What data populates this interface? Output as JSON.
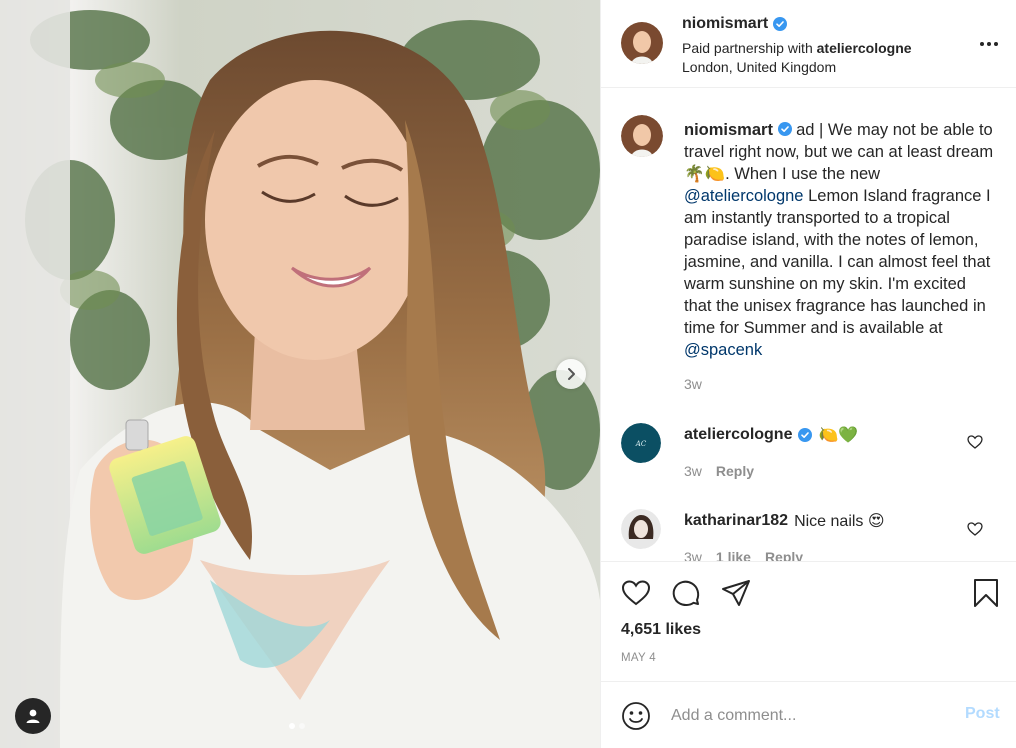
{
  "post": {
    "author": "niomismart",
    "partnership_prefix": "Paid partnership with",
    "partner": "ateliercologne",
    "location": "London, United Kingdom",
    "more_icon": "more-horizontal-icon"
  },
  "caption": {
    "username": "niomismart",
    "part1": "ad | We may not be able to travel right now, but we can at least dream 🌴🍋. When I use the new",
    "mention1": "@ateliercologne",
    "part2": "Lemon Island fragrance I am instantly transported to a tropical paradise island, with the notes of lemon, jasmine, and vanilla. I can almost feel that warm sunshine on my skin. I'm excited that the unisex fragrance has launched in time for Summer and is available at",
    "mention2": "@spacenk",
    "time": "3w"
  },
  "comments": [
    {
      "username": "ateliercologne",
      "text": "🍋💚",
      "time": "3w",
      "reply_label": "Reply",
      "verified": true
    },
    {
      "username": "katharinar182",
      "text": "Nice nails 😍",
      "time": "3w",
      "likes": "1 like",
      "reply_label": "Reply",
      "verified": false
    }
  ],
  "actions": {
    "likes": "4,651 likes",
    "date": "MAY 4",
    "icons": [
      "heart-icon",
      "comment-icon",
      "share-icon",
      "bookmark-icon"
    ]
  },
  "add_comment": {
    "placeholder": "Add a comment...",
    "post_label": "Post"
  },
  "colors": {
    "verified": "#3897f0",
    "link": "#00376b",
    "muted": "#8e8e8e",
    "post_disabled": "#b3dbff"
  }
}
